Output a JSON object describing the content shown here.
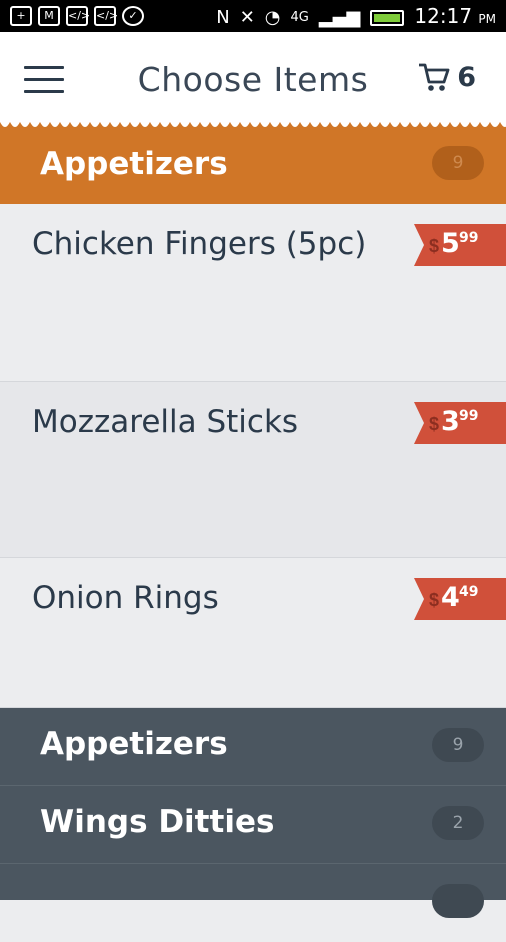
{
  "status_bar": {
    "icons": [
      "plus-icon",
      "gmail-icon",
      "code-icon",
      "code-icon",
      "check-icon",
      "nfc-icon",
      "mute-icon",
      "wifi-icon",
      "4g-lte-icon",
      "signal-icon",
      "battery-icon"
    ],
    "time": "12:17",
    "ampm": "PM"
  },
  "app_bar": {
    "title": "Choose Items",
    "cart_count": "6"
  },
  "section": {
    "label": "Appetizers",
    "count": "9",
    "accent": "#d07627"
  },
  "items": [
    {
      "name": "Chicken Fingers (5pc)",
      "currency": "$",
      "whole": "5",
      "cents": "99"
    },
    {
      "name": "Mozzarella Sticks",
      "currency": "$",
      "whole": "3",
      "cents": "99"
    },
    {
      "name": "Onion Rings",
      "currency": "$",
      "whole": "4",
      "cents": "49"
    }
  ],
  "categories": [
    {
      "label": "Appetizers",
      "count": "9"
    },
    {
      "label": "Wings Ditties",
      "count": "2"
    }
  ],
  "colors": {
    "price_tag": "#d0503a",
    "drawer_bg": "#4b5660"
  }
}
